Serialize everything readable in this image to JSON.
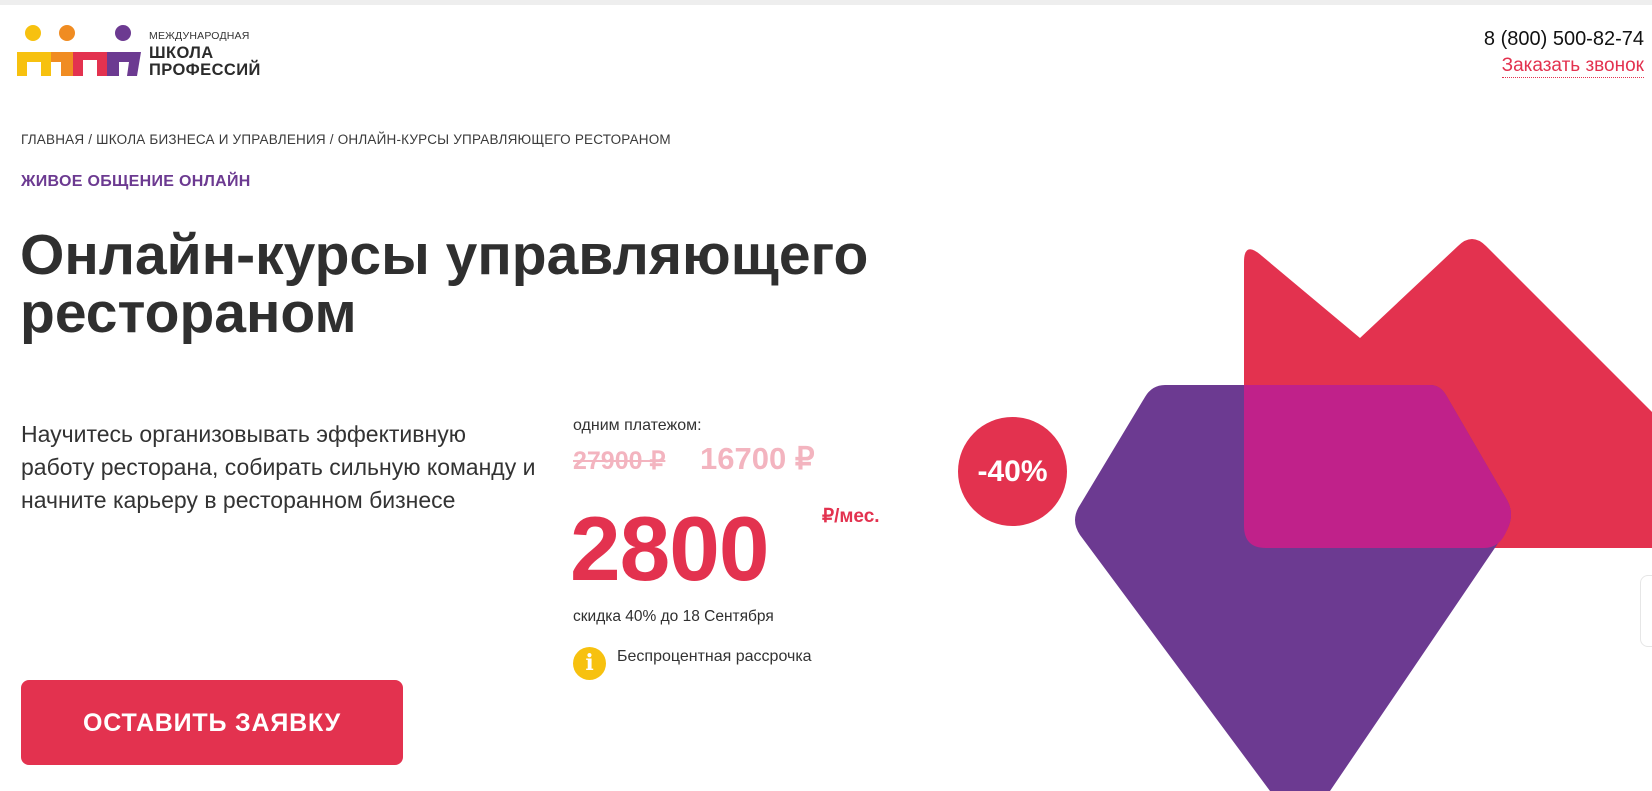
{
  "header": {
    "logo": {
      "line1": "МЕЖДУНАРОДНАЯ",
      "line2": "ШКОЛА",
      "line3": "ПРОФЕССИЙ",
      "colors": [
        "#f7c10f",
        "#f08c22",
        "#e3324f",
        "#6c3a91"
      ]
    },
    "phone": "8 (800) 500-82-74",
    "callback_label": "Заказать звонок"
  },
  "breadcrumb": "ГЛАВНАЯ / ШКОЛА БИЗНЕСА И УПРАВЛЕНИЯ / ОНЛАЙН-КУРСЫ УПРАВЛЯЮЩЕГО РЕСТОРАНОМ",
  "eyebrow": "ЖИВОЕ ОБЩЕНИЕ ОНЛАЙН",
  "title": "Онлайн-курсы управляющего рестораном",
  "subtitle": "Научитесь организовывать эффективную работу ресторана, собирать сильную команду и начните карьеру в ресторанном бизнесе",
  "pricing": {
    "label": "одним платежом:",
    "old_price": "27900 ₽",
    "new_price": "16700 ₽",
    "monthly_price": "2800",
    "monthly_unit": "₽/мес.",
    "discount_note": "скидка 40% до 18 Сентября",
    "installment_label": "Беспроцентная рассрочка",
    "info_icon": "i"
  },
  "badge": "-40%",
  "cta_label": "ОСТАВИТЬ ЗАЯВКУ",
  "colors": {
    "accent": "#e3324f",
    "purple": "#6c3a91",
    "magenta": "#c0218a",
    "yellow": "#f7c10f",
    "faded_price": "#f3b4bf"
  }
}
